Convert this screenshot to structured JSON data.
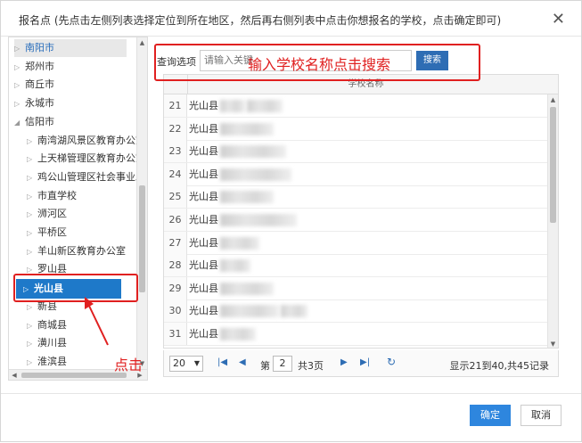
{
  "dialog": {
    "title": "报名点 (先点击左侧列表选择定位到所在地区，然后再右侧列表中点击你想报名的学校，点击确定即可)",
    "close": "✕"
  },
  "tree": {
    "items": [
      {
        "label": "南阳市",
        "arrow": "▷",
        "state": "highlight"
      },
      {
        "label": "郑州市",
        "arrow": "▷"
      },
      {
        "label": "商丘市",
        "arrow": "▷"
      },
      {
        "label": "永城市",
        "arrow": "▷"
      },
      {
        "label": "信阳市",
        "arrow": "◢"
      },
      {
        "label": "南湾湖风景区教育办公室",
        "arrow": "▷"
      },
      {
        "label": "上天梯管理区教育办公室",
        "arrow": "▷"
      },
      {
        "label": "鸡公山管理区社会事业发",
        "arrow": "▷"
      },
      {
        "label": "市直学校",
        "arrow": "▷"
      },
      {
        "label": "浉河区",
        "arrow": "▷"
      },
      {
        "label": "平桥区",
        "arrow": "▷"
      },
      {
        "label": "羊山新区教育办公室",
        "arrow": "▷"
      },
      {
        "label": "罗山县",
        "arrow": "▷"
      },
      {
        "label": "光山县",
        "arrow": "▷",
        "state": "selected"
      },
      {
        "label": "新县",
        "arrow": "▷"
      },
      {
        "label": "商城县",
        "arrow": "▷"
      },
      {
        "label": "潢川县",
        "arrow": "▷"
      },
      {
        "label": "淮滨县",
        "arrow": "▷"
      }
    ]
  },
  "search": {
    "label": "查询选项",
    "placeholder": "请输入关键",
    "button": "搜索"
  },
  "annotations": {
    "search_hint": "输入学校名称点击搜索",
    "click_hint": "点击"
  },
  "grid": {
    "column_header": "学校名称",
    "rows": [
      {
        "num": "21",
        "name": "光山县"
      },
      {
        "num": "22",
        "name": "光山县"
      },
      {
        "num": "23",
        "name": "光山县"
      },
      {
        "num": "24",
        "name": "光山县"
      },
      {
        "num": "25",
        "name": "光山县"
      },
      {
        "num": "26",
        "name": "光山县"
      },
      {
        "num": "27",
        "name": "光山县"
      },
      {
        "num": "28",
        "name": "光山县"
      },
      {
        "num": "29",
        "name": "光山县"
      },
      {
        "num": "30",
        "name": "光山县"
      },
      {
        "num": "31",
        "name": "光山县"
      }
    ]
  },
  "pager": {
    "page_size": "20",
    "page_prefix": "第",
    "current_page": "2",
    "page_suffix": "共3页",
    "info": "显示21到40,共45记录"
  },
  "footer": {
    "ok": "确定",
    "cancel": "取消"
  },
  "colors": {
    "accent": "#2e6db4",
    "selected": "#1e79c9",
    "annotation": "#e02020"
  }
}
